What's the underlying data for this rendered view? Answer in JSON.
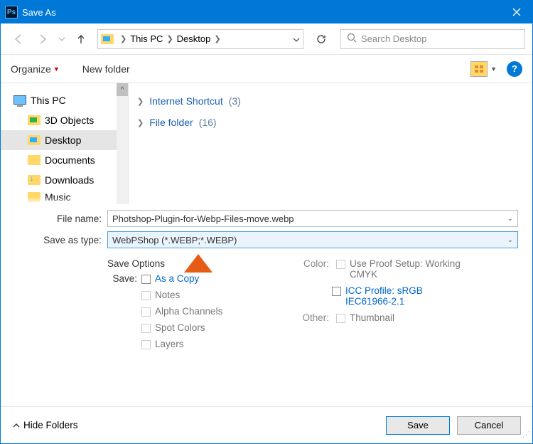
{
  "titlebar": {
    "title": "Save As"
  },
  "nav": {
    "breadcrumb": {
      "root": "This PC",
      "folder": "Desktop"
    },
    "search_placeholder": "Search Desktop"
  },
  "toolbar": {
    "organize": "Organize",
    "new_folder": "New folder",
    "help": "?"
  },
  "tree": {
    "items": [
      {
        "label": "This PC"
      },
      {
        "label": "3D Objects"
      },
      {
        "label": "Desktop"
      },
      {
        "label": "Documents"
      },
      {
        "label": "Downloads"
      },
      {
        "label": "Music"
      }
    ]
  },
  "filelist": {
    "groups": [
      {
        "name": "Internet Shortcut",
        "count": "(3)"
      },
      {
        "name": "File folder",
        "count": "(16)"
      }
    ]
  },
  "fields": {
    "filename_label": "File name:",
    "filename_value": "Photshop-Plugin-for-Webp-Files-move.webp",
    "type_label": "Save as type:",
    "type_value": "WebPShop (*.WEBP;*.WEBP)"
  },
  "save_options": {
    "header": "Save Options",
    "save_label": "Save:",
    "as_copy": "As a Copy",
    "notes": "Notes",
    "alpha": "Alpha Channels",
    "spot": "Spot Colors",
    "layers": "Layers",
    "color_label": "Color:",
    "proof": "Use Proof Setup: Working CMYK",
    "icc": "ICC Profile:  sRGB IEC61966-2.1",
    "other_label": "Other:",
    "thumb": "Thumbnail"
  },
  "bottom": {
    "hide_folders": "Hide Folders",
    "save": "Save",
    "cancel": "Cancel"
  }
}
